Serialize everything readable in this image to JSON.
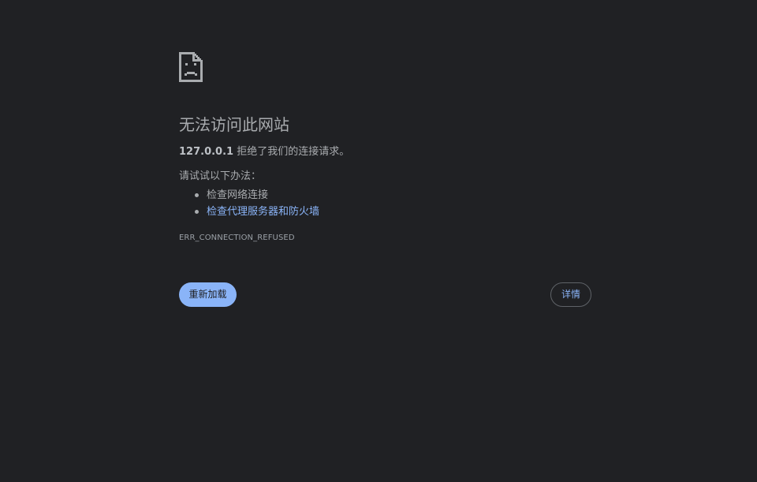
{
  "error_page": {
    "icon": "sad-document-icon",
    "title": "无法访问此网站",
    "summary": {
      "host": "127.0.0.1",
      "message": " 拒绝了我们的连接请求。"
    },
    "suggestions_heading": "请试试以下办法：",
    "suggestions": [
      {
        "text": "检查网络连接",
        "is_link": false
      },
      {
        "text": "检查代理服务器和防火墙",
        "is_link": true
      }
    ],
    "error_code": "ERR_CONNECTION_REFUSED",
    "reload_label": "重新加载",
    "details_label": "详情"
  },
  "colors": {
    "background": "#202124",
    "text": "#a9acaf",
    "accent": "#8ab4f8",
    "button_border": "#5f6368"
  }
}
